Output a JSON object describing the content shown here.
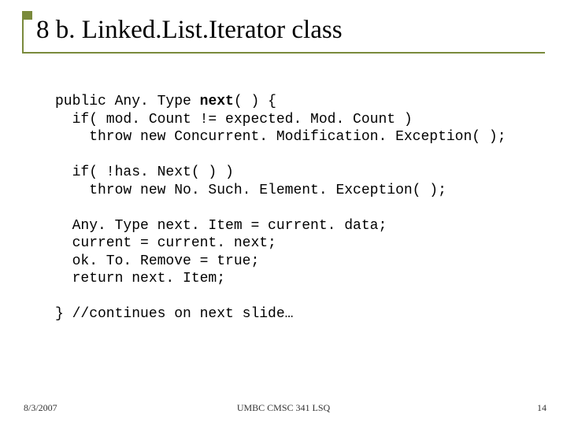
{
  "title": "8 b. Linked.List.Iterator class",
  "code": {
    "l1a": "public Any. Type ",
    "l1b": "next",
    "l1c": "( ) {",
    "l2": "  if( mod. Count != expected. Mod. Count )",
    "l3": "    throw new Concurrent. Modification. Exception( );",
    "l4": "  if( !has. Next( ) )",
    "l5": "    throw new No. Such. Element. Exception( );",
    "l6": "  Any. Type next. Item = current. data;",
    "l7": "  current = current. next;",
    "l8": "  ok. To. Remove = true;",
    "l9": "  return next. Item;",
    "l10": "} //continues on next slide…"
  },
  "footer": {
    "date": "8/3/2007",
    "center": "UMBC CMSC 341 LSQ",
    "page": "14"
  }
}
